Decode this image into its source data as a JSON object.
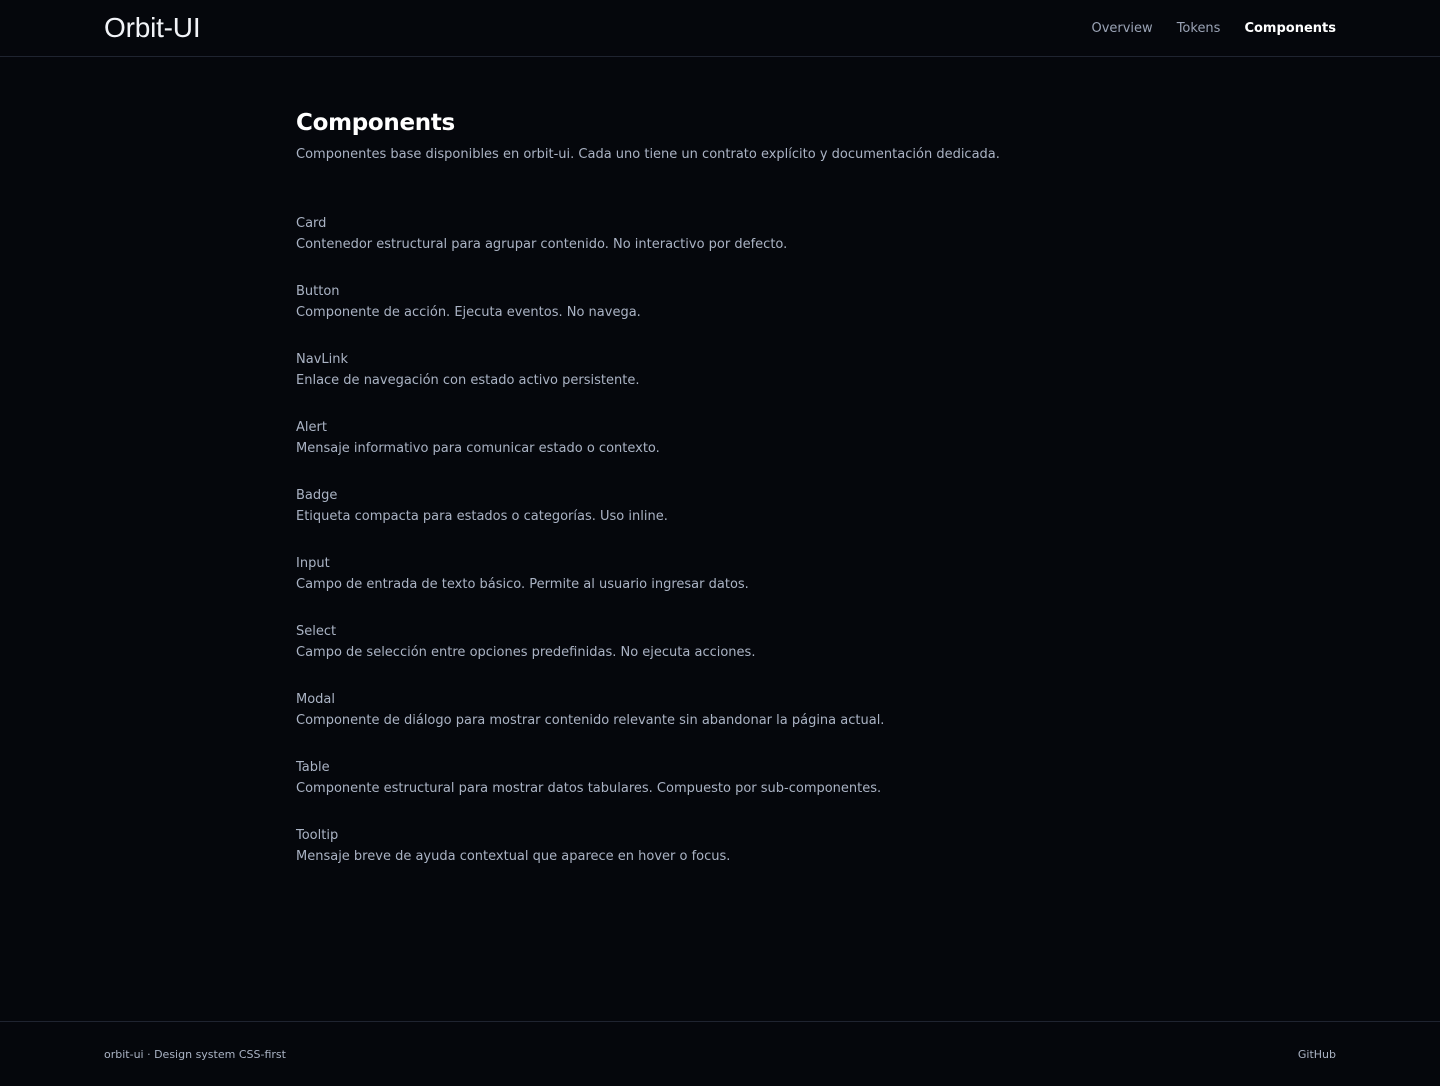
{
  "header": {
    "brand": "Orbit-UI",
    "nav": [
      {
        "label": "Overview",
        "active": false
      },
      {
        "label": "Tokens",
        "active": false
      },
      {
        "label": "Components",
        "active": true
      }
    ]
  },
  "main": {
    "title": "Components",
    "subtitle": "Componentes base disponibles en orbit-ui. Cada uno tiene un contrato explícito y documentación dedicada.",
    "components": [
      {
        "name": "Card",
        "description": "Contenedor estructural para agrupar contenido. No interactivo por defecto."
      },
      {
        "name": "Button",
        "description": "Componente de acción. Ejecuta eventos. No navega."
      },
      {
        "name": "NavLink",
        "description": "Enlace de navegación con estado activo persistente."
      },
      {
        "name": "Alert",
        "description": "Mensaje informativo para comunicar estado o contexto."
      },
      {
        "name": "Badge",
        "description": "Etiqueta compacta para estados o categorías. Uso inline."
      },
      {
        "name": "Input",
        "description": "Campo de entrada de texto básico. Permite al usuario ingresar datos."
      },
      {
        "name": "Select",
        "description": "Campo de selección entre opciones predefinidas. No ejecuta acciones."
      },
      {
        "name": "Modal",
        "description": "Componente de diálogo para mostrar contenido relevante sin abandonar la página actual."
      },
      {
        "name": "Table",
        "description": "Componente estructural para mostrar datos tabulares. Compuesto por sub-componentes."
      },
      {
        "name": "Tooltip",
        "description": "Mensaje breve de ayuda contextual que aparece en hover o focus."
      }
    ]
  },
  "footer": {
    "text": "orbit-ui · Design system CSS-first",
    "link": "GitHub"
  },
  "colors": {
    "background": "#05070c",
    "border": "#1f2430",
    "text_muted": "#aab3c4",
    "text_active": "#ffffff"
  }
}
